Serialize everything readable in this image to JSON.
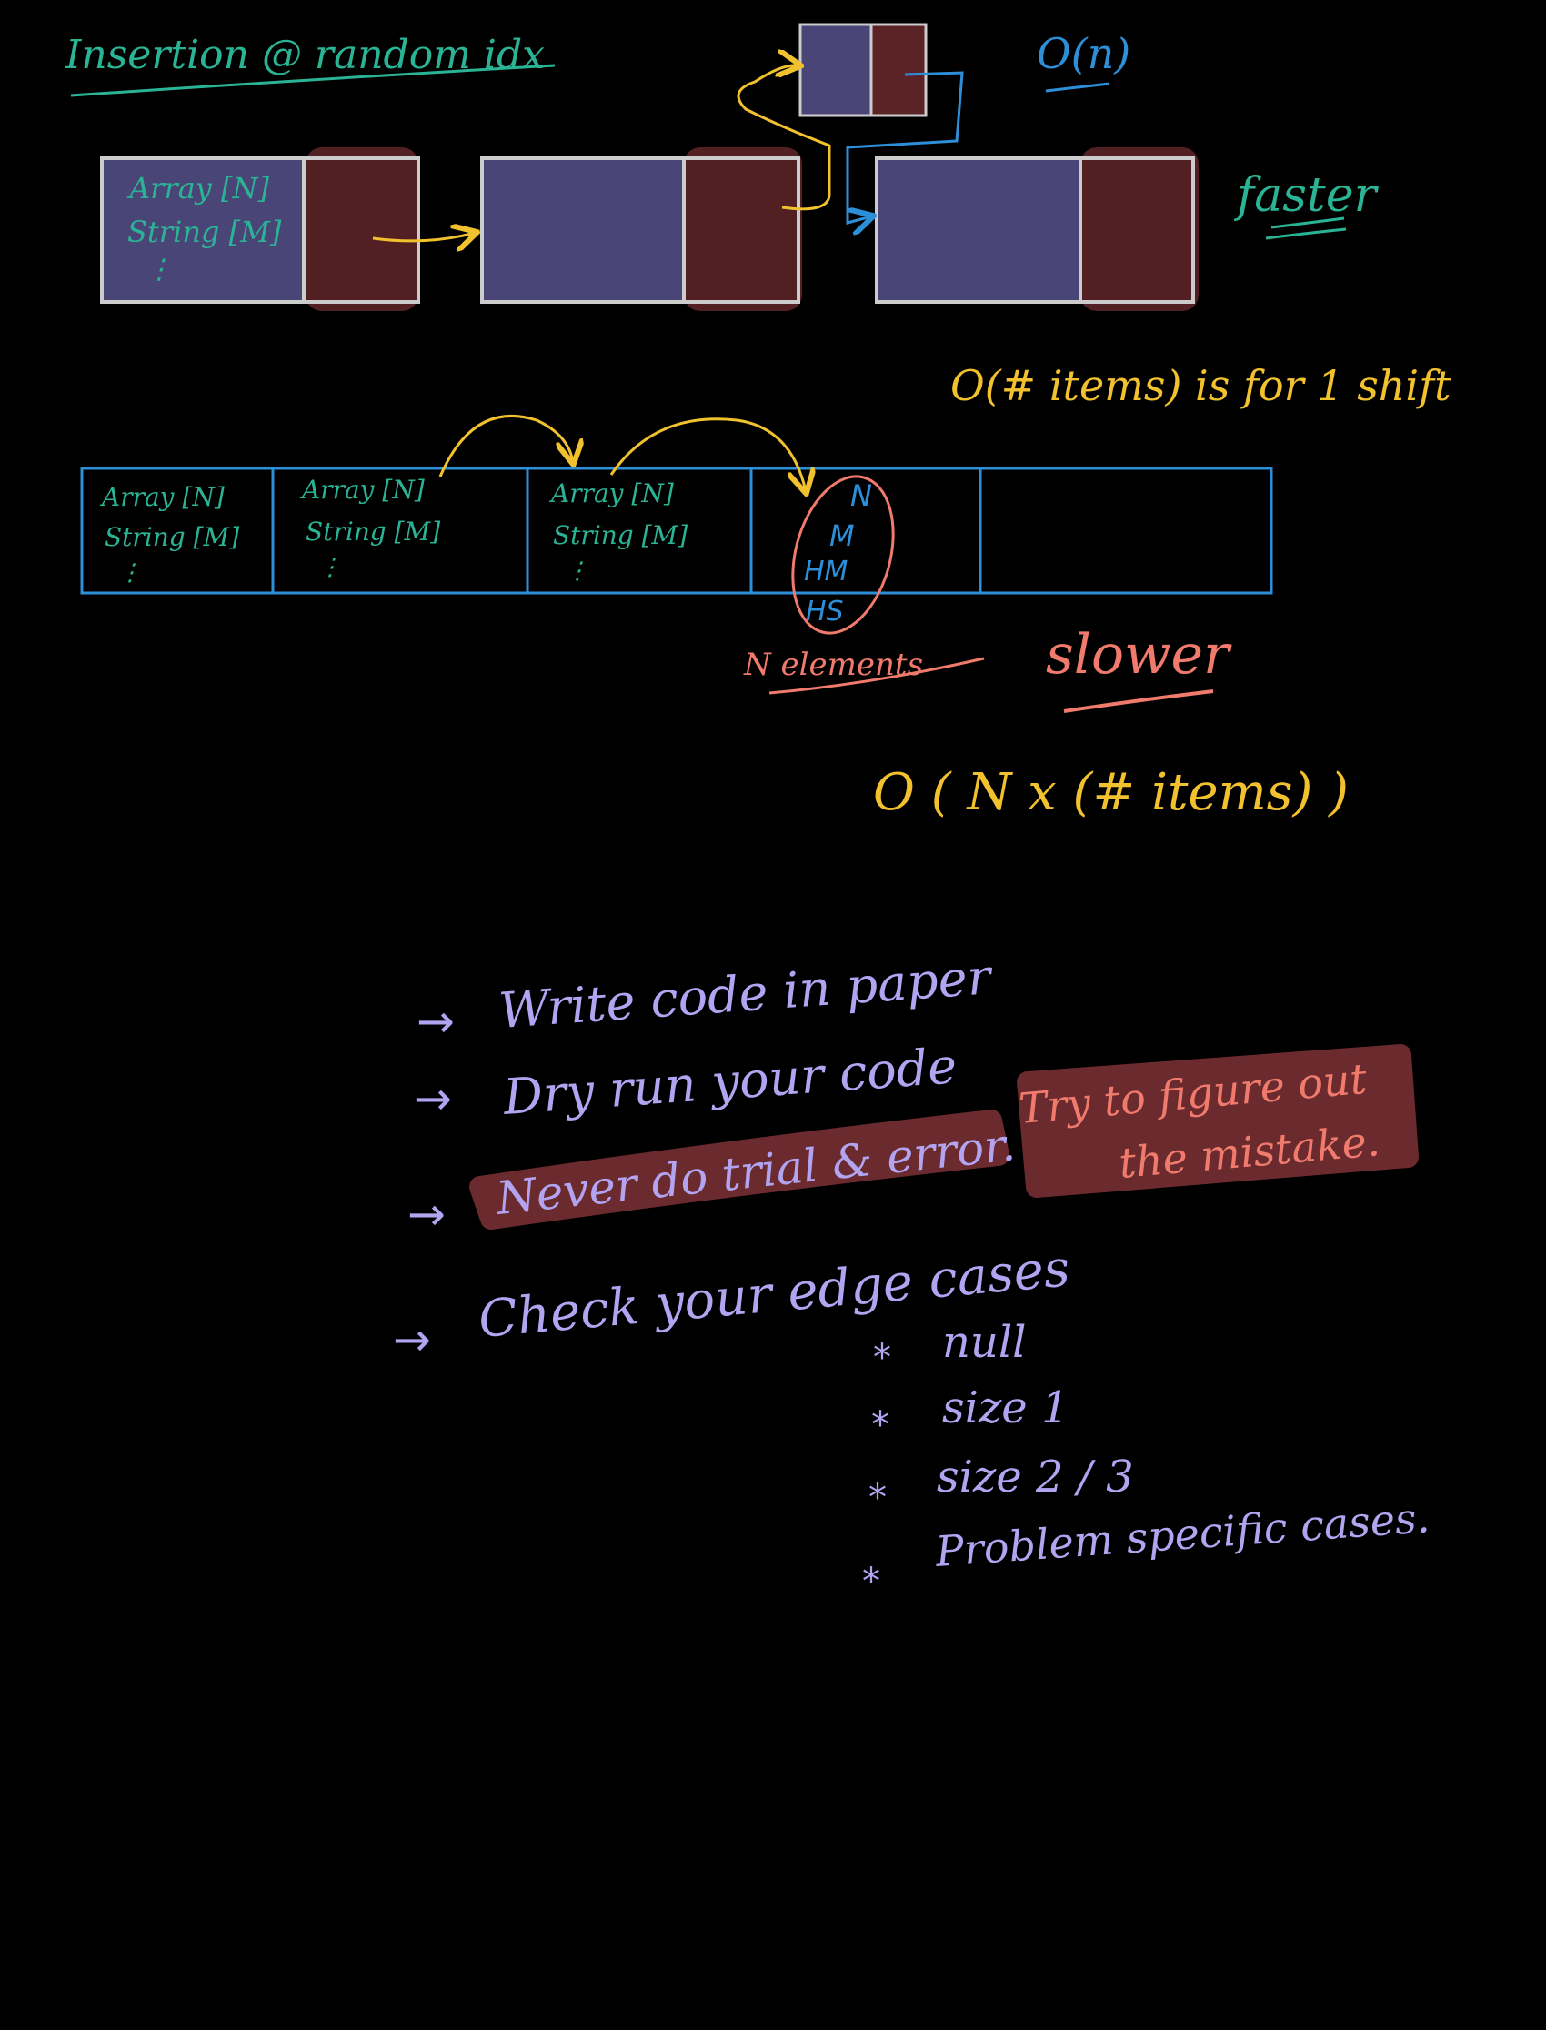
{
  "colors": {
    "background": "#000000",
    "teal": "#2ab394",
    "yellow": "#f2c12e",
    "blue": "#2e8fd9",
    "salmon": "#f07a6c",
    "lavender": "#b3a4f2",
    "node_data_fill": "#4a4577",
    "node_next_fill": "#5b2326",
    "node_border": "#cccccc",
    "highlight": "#6a2a2e"
  },
  "title": "Insertion @ random idx",
  "complexity_linked_list": "O(n)",
  "label_faster": "faster",
  "note_one_shift": "O(# items)  is for 1 shift",
  "label_slower": "slower",
  "label_n_elements": "N elements",
  "complexity_array": "O ( N x (# items) )",
  "linked_list_node_text": {
    "line1": "Array [N]",
    "line2": "String [M]",
    "line3": "⋮"
  },
  "array_cell_text": {
    "line1": "Array [N]",
    "line2": "String [M]",
    "line3": "⋮"
  },
  "inserted_items": [
    "N",
    "M",
    "HM",
    "HS"
  ],
  "tips": [
    "Write code in paper",
    "Dry run your code",
    "Never do trial & error.",
    "Check your edge cases"
  ],
  "tip_arrow": "→",
  "tip_note": {
    "line1": "Try to figure out",
    "line2": "the mistake."
  },
  "edge_case_bullet": "*",
  "edge_cases": [
    "null",
    "size 1",
    "size 2 / 3",
    "Problem specific cases."
  ]
}
